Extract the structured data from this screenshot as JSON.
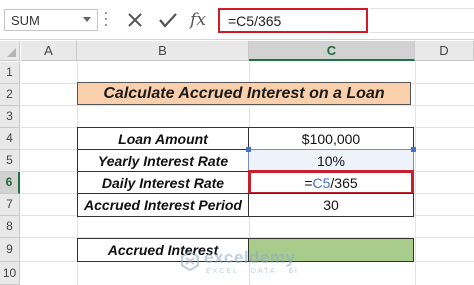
{
  "formula_bar": {
    "name_box": "SUM",
    "formula": "=C5/365",
    "fx_symbol": "fx",
    "icons": [
      "cancel-icon",
      "enter-icon",
      "fx-icon"
    ]
  },
  "columns": [
    "A",
    "B",
    "C",
    "D"
  ],
  "rows": [
    "1",
    "2",
    "3",
    "4",
    "5",
    "6",
    "7",
    "8",
    "9",
    "10"
  ],
  "sheet": {
    "title": "Calculate Accrued Interest on a Loan",
    "table": [
      {
        "label": "Loan Amount",
        "value": "$100,000"
      },
      {
        "label": "Yearly Interest Rate",
        "value": "10%"
      },
      {
        "label": "Daily Interest Rate",
        "value_prefix": "=",
        "value_ref": "C5",
        "value_suffix": "/365"
      },
      {
        "label": "Accrued Interest Period",
        "value": "30"
      }
    ],
    "result": {
      "label": "Accrued Interest",
      "value": ""
    }
  },
  "watermark": {
    "name": "exceldemy",
    "tagline": "EXCEL · DATA · BI"
  },
  "colors": {
    "title_fill": "#f9cfac",
    "result_fill": "#a7cc8b",
    "highlight_border": "#c62030",
    "reference_blue": "#4472c4",
    "selected_header": "#217346"
  }
}
